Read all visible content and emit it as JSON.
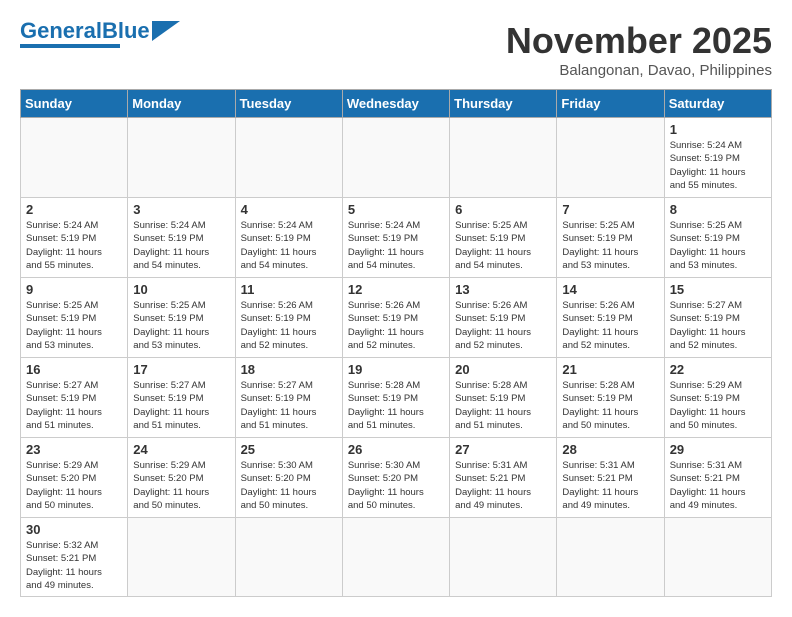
{
  "header": {
    "logo_general": "General",
    "logo_blue": "Blue",
    "month_title": "November 2025",
    "subtitle": "Balangonan, Davao, Philippines"
  },
  "weekdays": [
    "Sunday",
    "Monday",
    "Tuesday",
    "Wednesday",
    "Thursday",
    "Friday",
    "Saturday"
  ],
  "weeks": [
    [
      {
        "day": "",
        "info": ""
      },
      {
        "day": "",
        "info": ""
      },
      {
        "day": "",
        "info": ""
      },
      {
        "day": "",
        "info": ""
      },
      {
        "day": "",
        "info": ""
      },
      {
        "day": "",
        "info": ""
      },
      {
        "day": "1",
        "info": "Sunrise: 5:24 AM\nSunset: 5:19 PM\nDaylight: 11 hours\nand 55 minutes."
      }
    ],
    [
      {
        "day": "2",
        "info": "Sunrise: 5:24 AM\nSunset: 5:19 PM\nDaylight: 11 hours\nand 55 minutes."
      },
      {
        "day": "3",
        "info": "Sunrise: 5:24 AM\nSunset: 5:19 PM\nDaylight: 11 hours\nand 54 minutes."
      },
      {
        "day": "4",
        "info": "Sunrise: 5:24 AM\nSunset: 5:19 PM\nDaylight: 11 hours\nand 54 minutes."
      },
      {
        "day": "5",
        "info": "Sunrise: 5:24 AM\nSunset: 5:19 PM\nDaylight: 11 hours\nand 54 minutes."
      },
      {
        "day": "6",
        "info": "Sunrise: 5:25 AM\nSunset: 5:19 PM\nDaylight: 11 hours\nand 54 minutes."
      },
      {
        "day": "7",
        "info": "Sunrise: 5:25 AM\nSunset: 5:19 PM\nDaylight: 11 hours\nand 53 minutes."
      },
      {
        "day": "8",
        "info": "Sunrise: 5:25 AM\nSunset: 5:19 PM\nDaylight: 11 hours\nand 53 minutes."
      }
    ],
    [
      {
        "day": "9",
        "info": "Sunrise: 5:25 AM\nSunset: 5:19 PM\nDaylight: 11 hours\nand 53 minutes."
      },
      {
        "day": "10",
        "info": "Sunrise: 5:25 AM\nSunset: 5:19 PM\nDaylight: 11 hours\nand 53 minutes."
      },
      {
        "day": "11",
        "info": "Sunrise: 5:26 AM\nSunset: 5:19 PM\nDaylight: 11 hours\nand 52 minutes."
      },
      {
        "day": "12",
        "info": "Sunrise: 5:26 AM\nSunset: 5:19 PM\nDaylight: 11 hours\nand 52 minutes."
      },
      {
        "day": "13",
        "info": "Sunrise: 5:26 AM\nSunset: 5:19 PM\nDaylight: 11 hours\nand 52 minutes."
      },
      {
        "day": "14",
        "info": "Sunrise: 5:26 AM\nSunset: 5:19 PM\nDaylight: 11 hours\nand 52 minutes."
      },
      {
        "day": "15",
        "info": "Sunrise: 5:27 AM\nSunset: 5:19 PM\nDaylight: 11 hours\nand 52 minutes."
      }
    ],
    [
      {
        "day": "16",
        "info": "Sunrise: 5:27 AM\nSunset: 5:19 PM\nDaylight: 11 hours\nand 51 minutes."
      },
      {
        "day": "17",
        "info": "Sunrise: 5:27 AM\nSunset: 5:19 PM\nDaylight: 11 hours\nand 51 minutes."
      },
      {
        "day": "18",
        "info": "Sunrise: 5:27 AM\nSunset: 5:19 PM\nDaylight: 11 hours\nand 51 minutes."
      },
      {
        "day": "19",
        "info": "Sunrise: 5:28 AM\nSunset: 5:19 PM\nDaylight: 11 hours\nand 51 minutes."
      },
      {
        "day": "20",
        "info": "Sunrise: 5:28 AM\nSunset: 5:19 PM\nDaylight: 11 hours\nand 51 minutes."
      },
      {
        "day": "21",
        "info": "Sunrise: 5:28 AM\nSunset: 5:19 PM\nDaylight: 11 hours\nand 50 minutes."
      },
      {
        "day": "22",
        "info": "Sunrise: 5:29 AM\nSunset: 5:19 PM\nDaylight: 11 hours\nand 50 minutes."
      }
    ],
    [
      {
        "day": "23",
        "info": "Sunrise: 5:29 AM\nSunset: 5:20 PM\nDaylight: 11 hours\nand 50 minutes."
      },
      {
        "day": "24",
        "info": "Sunrise: 5:29 AM\nSunset: 5:20 PM\nDaylight: 11 hours\nand 50 minutes."
      },
      {
        "day": "25",
        "info": "Sunrise: 5:30 AM\nSunset: 5:20 PM\nDaylight: 11 hours\nand 50 minutes."
      },
      {
        "day": "26",
        "info": "Sunrise: 5:30 AM\nSunset: 5:20 PM\nDaylight: 11 hours\nand 50 minutes."
      },
      {
        "day": "27",
        "info": "Sunrise: 5:31 AM\nSunset: 5:21 PM\nDaylight: 11 hours\nand 49 minutes."
      },
      {
        "day": "28",
        "info": "Sunrise: 5:31 AM\nSunset: 5:21 PM\nDaylight: 11 hours\nand 49 minutes."
      },
      {
        "day": "29",
        "info": "Sunrise: 5:31 AM\nSunset: 5:21 PM\nDaylight: 11 hours\nand 49 minutes."
      }
    ],
    [
      {
        "day": "30",
        "info": "Sunrise: 5:32 AM\nSunset: 5:21 PM\nDaylight: 11 hours\nand 49 minutes."
      },
      {
        "day": "",
        "info": ""
      },
      {
        "day": "",
        "info": ""
      },
      {
        "day": "",
        "info": ""
      },
      {
        "day": "",
        "info": ""
      },
      {
        "day": "",
        "info": ""
      },
      {
        "day": "",
        "info": ""
      }
    ]
  ]
}
